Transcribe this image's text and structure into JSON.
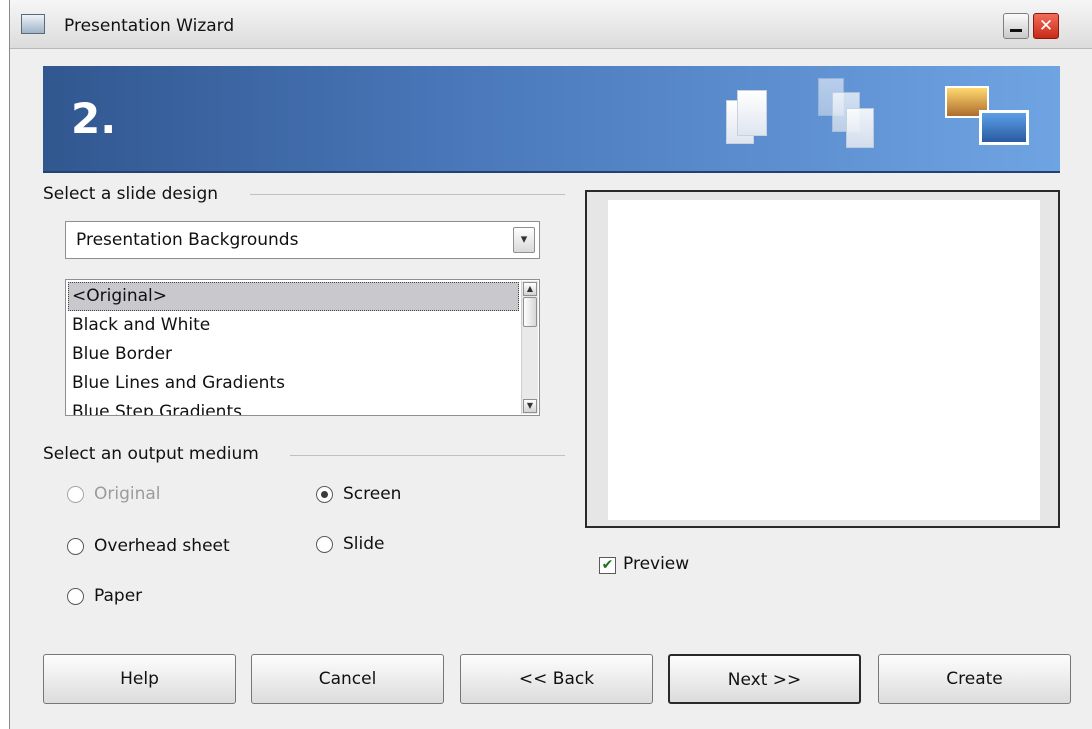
{
  "window": {
    "title": "Presentation Wizard",
    "close_glyph": "✕"
  },
  "banner": {
    "step": "2."
  },
  "design": {
    "section_label": "Select a slide design",
    "category_value": "Presentation Backgrounds",
    "category_arrow": "▾",
    "items": [
      "<Original>",
      "Black and White",
      "Blue Border",
      "Blue Lines and Gradients",
      "Blue Step Gradients"
    ],
    "selected_index": 0
  },
  "output": {
    "section_label": "Select an output medium",
    "options": {
      "original": {
        "label": "Original",
        "enabled": false,
        "checked": false
      },
      "overhead": {
        "label": "Overhead sheet",
        "enabled": true,
        "checked": false
      },
      "paper": {
        "label": "Paper",
        "enabled": true,
        "checked": false
      },
      "screen": {
        "label": "Screen",
        "enabled": true,
        "checked": true
      },
      "slide": {
        "label": "Slide",
        "enabled": true,
        "checked": false
      }
    }
  },
  "preview": {
    "checkbox_label": "Preview",
    "checked": true,
    "check_glyph": "✔"
  },
  "buttons": {
    "help": "Help",
    "cancel": "Cancel",
    "back": "<< Back",
    "next": "Next >>",
    "create": "Create"
  }
}
